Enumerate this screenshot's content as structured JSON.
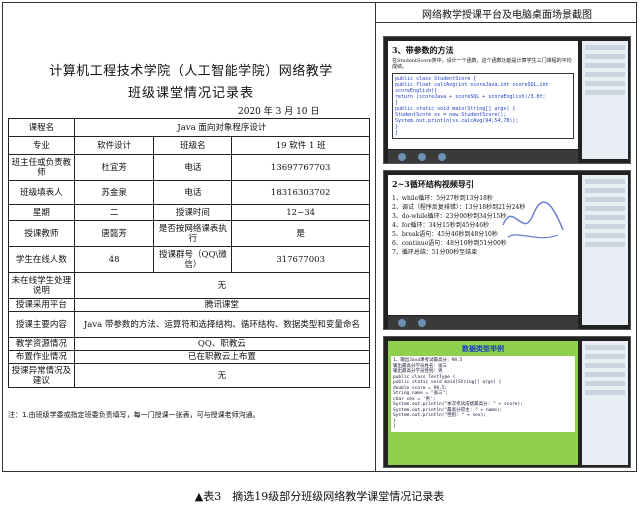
{
  "title_line1": "计算机工程技术学院（人工智能学院）网络教学",
  "title_line2": "班级课堂情况记录表",
  "date": "2020 年 3 月 10 日",
  "table": {
    "course_label": "课程名",
    "course_value": "Java 面向对象程序设计",
    "major_label": "专业",
    "major_value": "软件设计",
    "class_label": "班级名",
    "class_value": "19 软件 1 班",
    "monitor_label": "班主任或负责教师",
    "monitor_name": "杜宜芳",
    "phone_label": "电话",
    "monitor_phone": "13697767703",
    "filler_label": "班级填表人",
    "filler_name": "苏金泉",
    "filler_phone": "18316303702",
    "weekday_label": "星期",
    "weekday_value": "二",
    "time_label": "授课时间",
    "time_value": "12~34",
    "teacher_label": "授课教师",
    "teacher_value": "唐懿芳",
    "schedule_label": "是否按网络课表执行",
    "schedule_value": "是",
    "online_label": "学生在线人数",
    "online_value": "48",
    "group_label": "授课群号（QQ\\微信）",
    "group_value": "317677003",
    "absent_label": "未在线学生处理说明",
    "absent_value": "无",
    "platform_label": "授课采用平台",
    "platform_value": "腾讯课堂",
    "content_label": "授课主要内容",
    "content_value": "Java 带参数的方法、运算符和选择结构、循环结构、数据类型和变量命名",
    "resource_label": "教学资源情况",
    "resource_value": "QQ、职教云",
    "homework_label": "布置作业情况",
    "homework_value": "已在职教云上布置",
    "issue_label": "授课异常情况及建议",
    "issue_value": "无"
  },
  "note": "注：1.由班级学委或指定班委负责填写，每一门授课一张表，可与授课老师沟通。",
  "right_title": "网络教学授课平台及电脑桌面场景截图",
  "screens": {
    "s1_heading": "3、带参数的方法",
    "s1_bullet": "在StudentScore类中，设计一个函数，这个函数功能是计算学生三门课程的平均成绩。",
    "s1_code": [
      "public class StudentScore {",
      "  public float calcAvg(int scoreJava,int scoreSQL,int scoreEnglish){",
      "    return (scoreJava + scoreSQL + scoreEnglish)/3.0f;",
      "  }",
      "  public static void main(String[] args) {",
      "    StudentScore ss = new StudentScore();",
      "    System.out.println(ss.calcAvg(94,54,78));",
      "  }",
      "}"
    ],
    "s2_heading": "2~3循环结构视频导引",
    "s2_items": [
      "1、while循环：5分27秒到13分18秒",
      "2、调试（程序反复排错）：13分18秒到21分24秒",
      "3、do-while循环：23分00秒到34分15秒",
      "4、for循环：34分15秒到45分46秒",
      "5、break语句：45分46秒到48分10秒",
      "6、continue语句：48分10秒到51分00秒",
      "7、循环总结：51分00秒至结束"
    ],
    "s3_heading": "数据类型举例",
    "s3_code": [
      "1、输出Java课考试最高分：98.5",
      "   输出最高分学员姓名：张三",
      "   输出最高分学员性别：男",
      "public class TestType {",
      "  public static void main(String[] args) {",
      "    double score = 98.5;",
      "    String name = \"张三\";",
      "    char sex = '男';",
      "    System.out.println(\"本次考试成绩最高分: \" + score);",
      "    System.out.println(\"最高分得主: \" + name);",
      "    System.out.println(\"性别: \" + sex);",
      "  }",
      "}"
    ]
  },
  "caption": "▲表3　摘选19级部分班级网络教学课堂情况记录表"
}
